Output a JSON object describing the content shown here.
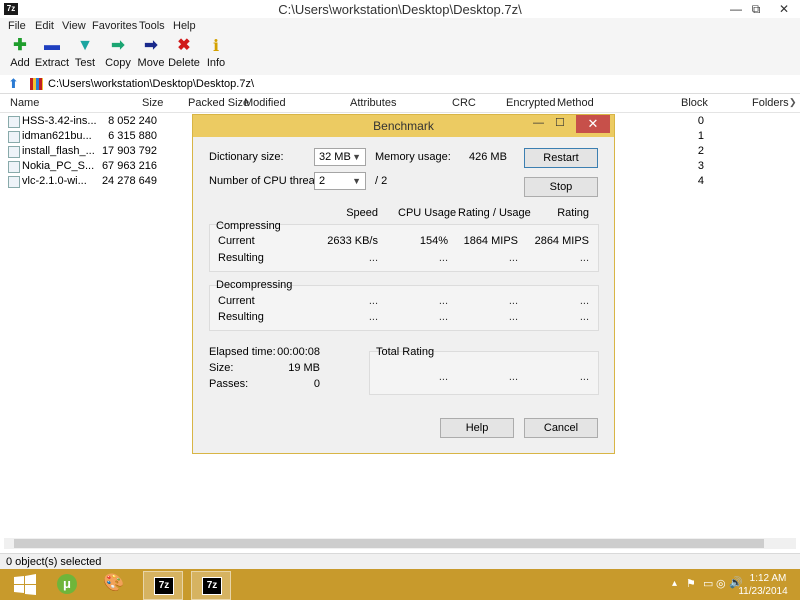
{
  "window": {
    "icon_text": "7z",
    "title": "C:\\Users\\workstation\\Desktop\\Desktop.7z\\",
    "min_glyph": "—",
    "max_glyph": "⧉",
    "close_glyph": "✕"
  },
  "menu": [
    "File",
    "Edit",
    "View",
    "Favorites",
    "Tools",
    "Help"
  ],
  "toolbar": [
    {
      "label": "Add",
      "icon": "add-icon",
      "glyph": "✚",
      "color": "#1f9e2c"
    },
    {
      "label": "Extract",
      "icon": "extract-icon",
      "glyph": "▬",
      "color": "#1f3fbf"
    },
    {
      "label": "Test",
      "icon": "test-icon",
      "glyph": "▼",
      "color": "#1ba5a0"
    },
    {
      "label": "Copy",
      "icon": "copy-icon",
      "glyph": "➡",
      "color": "#1ba572"
    },
    {
      "label": "Move",
      "icon": "move-icon",
      "glyph": "➡",
      "color": "#1a2a8c"
    },
    {
      "label": "Delete",
      "icon": "delete-icon",
      "glyph": "✖",
      "color": "#d01818"
    },
    {
      "label": "Info",
      "icon": "info-icon",
      "glyph": "i",
      "color": "#d4a100"
    }
  ],
  "address": "C:\\Users\\workstation\\Desktop\\Desktop.7z\\",
  "columns": [
    "Name",
    "Size",
    "Packed Size",
    "Modified",
    "Attributes",
    "CRC",
    "Encrypted",
    "Method",
    "Block",
    "Folders"
  ],
  "files": [
    {
      "name": "HSS-3.42-ins...",
      "size": "8 052 240",
      "block": "0"
    },
    {
      "name": "idman621bu...",
      "size": "6 315 880",
      "block": "1"
    },
    {
      "name": "install_flash_...",
      "size": "17 903 792",
      "block": "2"
    },
    {
      "name": "Nokia_PC_S...",
      "size": "67 963 216",
      "block": "3"
    },
    {
      "name": "vlc-2.1.0-wi...",
      "size": "24 278 649",
      "block": "4"
    }
  ],
  "status": "0 object(s) selected",
  "dialog": {
    "title": "Benchmark",
    "min_glyph": "—",
    "max_glyph": "☐",
    "close_glyph": "✕",
    "dict_label": "Dictionary size:",
    "dict_value": "32 MB",
    "threads_label": "Number of CPU threads:",
    "threads_value": "2",
    "threads_max": "/ 2",
    "mem_label": "Memory usage:",
    "mem_value": "426 MB",
    "restart": "Restart",
    "stop": "Stop",
    "headers": [
      "Speed",
      "CPU Usage",
      "Rating / Usage",
      "Rating"
    ],
    "compressing": {
      "title": "Compressing",
      "current_label": "Current",
      "current": [
        "2633 KB/s",
        "154%",
        "1864 MIPS",
        "2864 MIPS"
      ],
      "resulting_label": "Resulting",
      "resulting": [
        "...",
        "...",
        "...",
        "..."
      ]
    },
    "decompressing": {
      "title": "Decompressing",
      "current_label": "Current",
      "current": [
        "...",
        "...",
        "...",
        "..."
      ],
      "resulting_label": "Resulting",
      "resulting": [
        "...",
        "...",
        "...",
        "..."
      ]
    },
    "elapsed_label": "Elapsed time:",
    "elapsed_value": "00:00:08",
    "size_label": "Size:",
    "size_value": "19 MB",
    "passes_label": "Passes:",
    "passes_value": "0",
    "total_label": "Total Rating",
    "total": [
      "...",
      "...",
      "..."
    ],
    "help": "Help",
    "cancel": "Cancel"
  },
  "taskbar": {
    "apps": [
      {
        "name": "utorrent",
        "glyph": "μ"
      },
      {
        "name": "paint",
        "glyph": "🎨"
      },
      {
        "name": "7zip-1",
        "glyph": "7z"
      },
      {
        "name": "7zip-2",
        "glyph": "7z"
      }
    ],
    "tray_glyphs": [
      "▴",
      "⚑",
      "▭",
      "◎",
      "🔊"
    ],
    "time": "1:12 AM",
    "date": "11/23/2014"
  }
}
